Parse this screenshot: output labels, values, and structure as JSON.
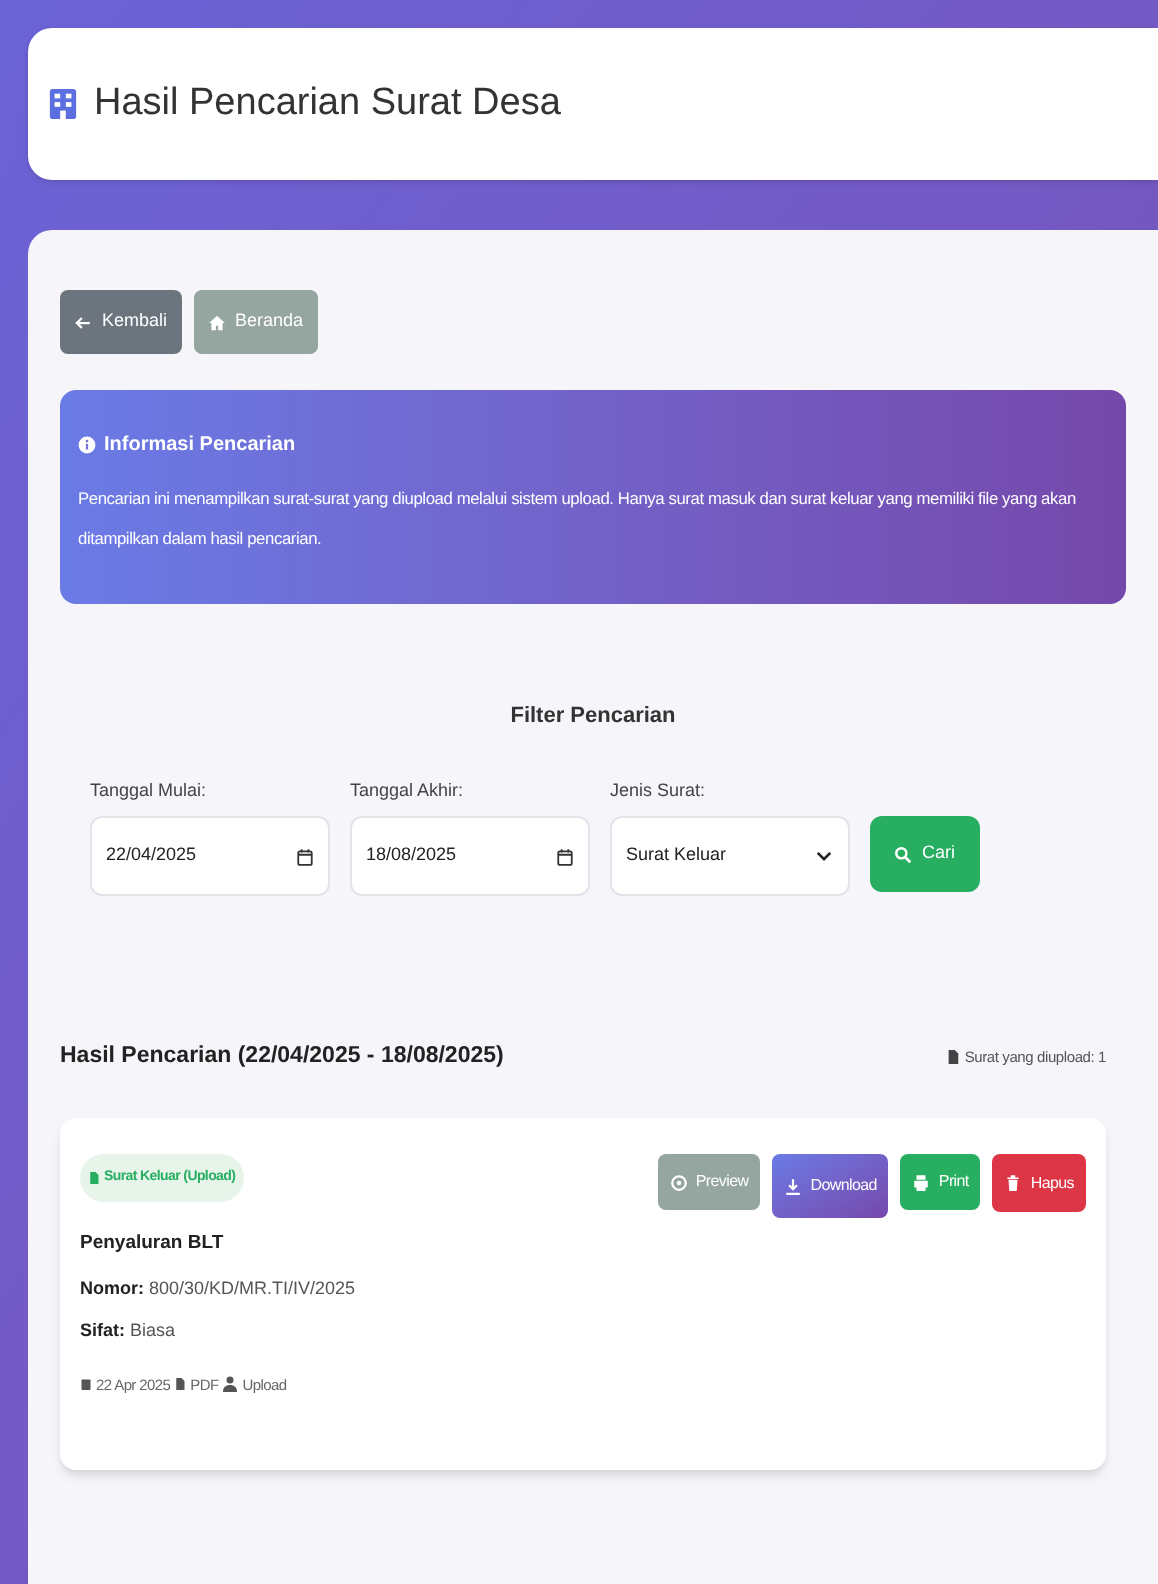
{
  "header": {
    "title": "Hasil Pencarian Surat Desa"
  },
  "nav_buttons": [
    {
      "label": "Kembali",
      "kind": "back"
    },
    {
      "label": "Beranda",
      "kind": "home"
    }
  ],
  "info": {
    "title": "Informasi Pencarian",
    "text": "Pencarian ini menampilkan surat-surat yang diupload melalui sistem upload. Hanya surat masuk dan surat keluar yang memiliki file yang akan ditampilkan dalam hasil pencarian."
  },
  "filter": {
    "title": "Filter Pencarian",
    "fields": [
      {
        "label": "Tanggal Mulai:",
        "kind": "date",
        "value": "22/04/2025"
      },
      {
        "label": "Tanggal Akhir:",
        "kind": "date",
        "value": "18/08/2025"
      },
      {
        "label": "Jenis Surat:",
        "kind": "select",
        "value": "Surat Keluar"
      }
    ],
    "button": "Cari"
  },
  "results": {
    "heading": "Hasil Pencarian (22/04/2025 - 18/08/2025)",
    "count": "Surat yang diupload: 1"
  },
  "items": [
    {
      "badge": "Surat Keluar (Upload)",
      "title": "Penyaluran BLT",
      "nomor_label": "Nomor:",
      "nomor": "800/30/KD/MR.TI/IV/2025",
      "sifat_label": "Sifat:",
      "sifat": "Biasa",
      "date": "22 Apr 2025",
      "file_type": "PDF",
      "source": "Upload",
      "actions": [
        {
          "label": "Preview",
          "kind": "preview"
        },
        {
          "label": "Download",
          "kind": "download"
        },
        {
          "label": "Print",
          "kind": "print"
        },
        {
          "label": "Hapus",
          "kind": "delete"
        }
      ]
    }
  ]
}
